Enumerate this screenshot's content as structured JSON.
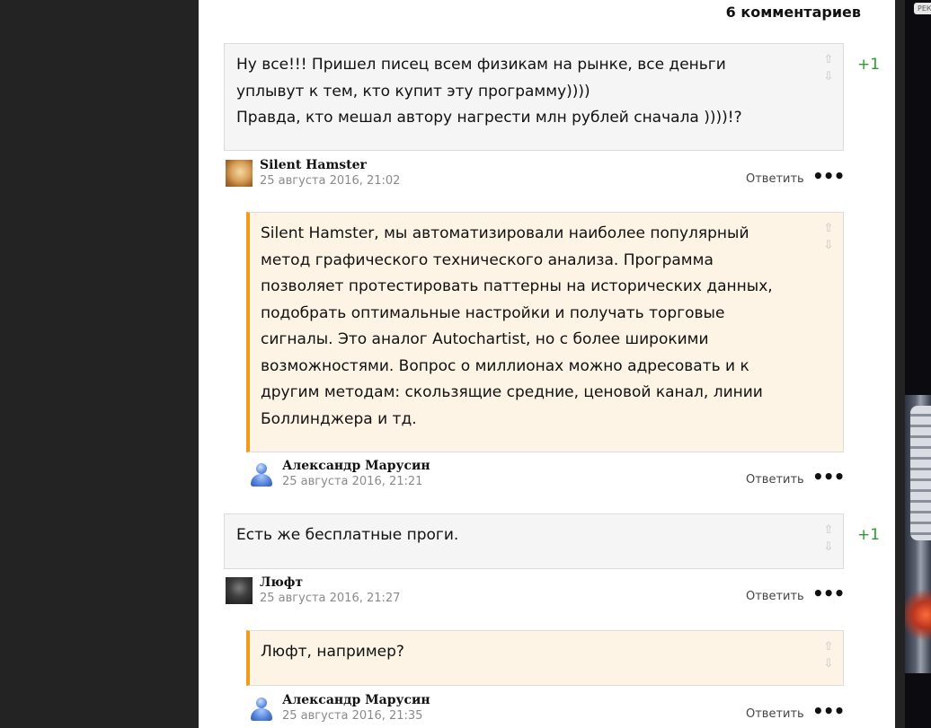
{
  "header": {
    "comment_count": "6 комментариев"
  },
  "ad": {
    "label": "РЕК"
  },
  "vote": {
    "up_icon": "⇧",
    "down_icon": "⇩"
  },
  "actions": {
    "reply": "Ответить",
    "more": "•••"
  },
  "comments": [
    {
      "text": "Ну все!!! Пришел писец всем физикам на рынке, все деньги уплывут к тем, кто купит эту программу))))\nПравда, кто мешал автору нагрести млн рублей сначала ))))!?",
      "score": "+1",
      "author": "Silent Hamster",
      "date": "25 августа 2016, 21:02"
    },
    {
      "text": "Silent Hamster, мы автоматизировали наиболее популярный метод графического технического анализа. Программа позволяет протестировать паттерны на исторических данных, подобрать оптимальные настройки и получать торговые сигналы. Это аналог Autochartist, но с более широкими возможностями. Вопрос о миллионах можно адресовать и к другим методам: скользящие средние, ценовой канал, линии Боллинджера и тд.",
      "author": "Александр Марусин",
      "date": "25 августа 2016, 21:21"
    },
    {
      "text": "Есть же бесплатные проги.",
      "score": "+1",
      "author": "Люфт",
      "date": "25 августа 2016, 21:27"
    },
    {
      "text": "Люфт, например?",
      "author": "Александр Марусин",
      "date": "25 августа 2016, 21:35"
    }
  ]
}
